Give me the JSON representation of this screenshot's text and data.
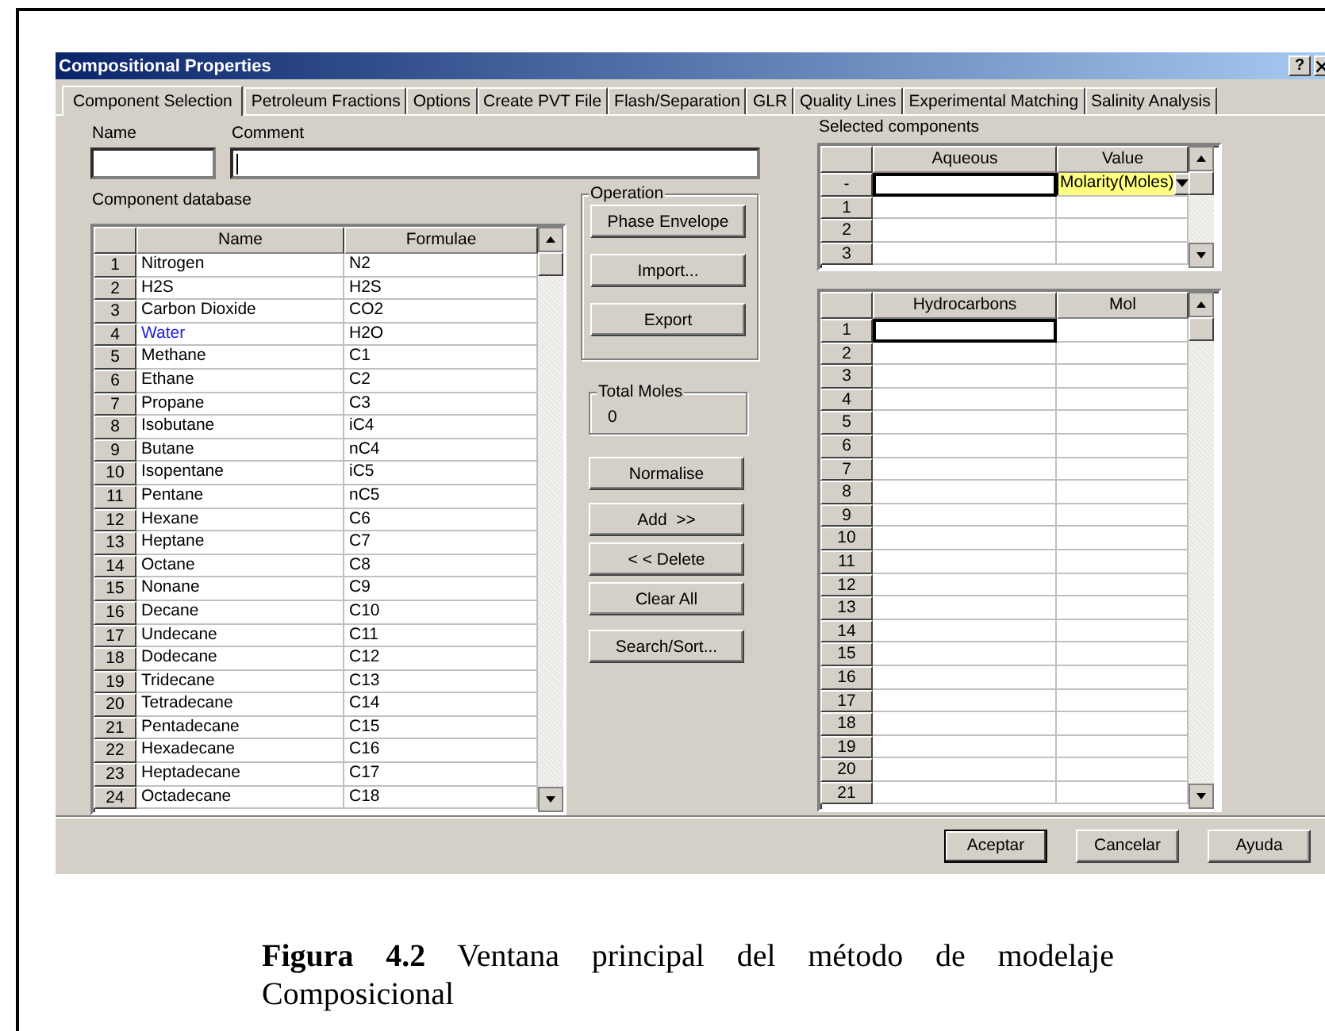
{
  "window": {
    "title": "Compositional Properties",
    "help_button": "?"
  },
  "tabs": [
    {
      "label": "Component Selection",
      "selected": true
    },
    {
      "label": "Petroleum Fractions",
      "selected": false
    },
    {
      "label": "Options",
      "selected": false
    },
    {
      "label": "Create PVT File",
      "selected": false
    },
    {
      "label": "Flash/Separation",
      "selected": false
    },
    {
      "label": "GLR",
      "selected": false
    },
    {
      "label": "Quality Lines",
      "selected": false
    },
    {
      "label": "Experimental Matching",
      "selected": false
    },
    {
      "label": "Salinity Analysis",
      "selected": false
    }
  ],
  "name_field": {
    "label": "Name"
  },
  "comment_field": {
    "label": "Comment",
    "focused": true
  },
  "component_database": {
    "label": "Component database",
    "columns": [
      "Name",
      "Formulae"
    ],
    "rows": [
      {
        "number": "1",
        "name": "Nitrogen",
        "formulae": "N2",
        "highlighted": false
      },
      {
        "number": "2",
        "name": "H2S",
        "formulae": "H2S",
        "highlighted": false
      },
      {
        "number": "3",
        "name": "Carbon Dioxide",
        "formulae": "CO2",
        "highlighted": false
      },
      {
        "number": "4",
        "name": "Water",
        "formulae": "H2O",
        "highlighted": true
      },
      {
        "number": "5",
        "name": "Methane",
        "formulae": "C1",
        "highlighted": false
      },
      {
        "number": "6",
        "name": "Ethane",
        "formulae": "C2",
        "highlighted": false
      },
      {
        "number": "7",
        "name": "Propane",
        "formulae": "C3",
        "highlighted": false
      },
      {
        "number": "8",
        "name": "Isobutane",
        "formulae": "iC4",
        "highlighted": false
      },
      {
        "number": "9",
        "name": "Butane",
        "formulae": "nC4",
        "highlighted": false
      },
      {
        "number": "10",
        "name": "Isopentane",
        "formulae": "iC5",
        "highlighted": false
      },
      {
        "number": "11",
        "name": "Pentane",
        "formulae": "nC5",
        "highlighted": false
      },
      {
        "number": "12",
        "name": "Hexane",
        "formulae": "C6",
        "highlighted": false
      },
      {
        "number": "13",
        "name": "Heptane",
        "formulae": "C7",
        "highlighted": false
      },
      {
        "number": "14",
        "name": "Octane",
        "formulae": "C8",
        "highlighted": false
      },
      {
        "number": "15",
        "name": "Nonane",
        "formulae": "C9",
        "highlighted": false
      },
      {
        "number": "16",
        "name": "Decane",
        "formulae": "C10",
        "highlighted": false
      },
      {
        "number": "17",
        "name": "Undecane",
        "formulae": "C11",
        "highlighted": false
      },
      {
        "number": "18",
        "name": "Dodecane",
        "formulae": "C12",
        "highlighted": false
      },
      {
        "number": "19",
        "name": "Tridecane",
        "formulae": "C13",
        "highlighted": false
      },
      {
        "number": "20",
        "name": "Tetradecane",
        "formulae": "C14",
        "highlighted": false
      },
      {
        "number": "21",
        "name": "Pentadecane",
        "formulae": "C15",
        "highlighted": false
      },
      {
        "number": "22",
        "name": "Hexadecane",
        "formulae": "C16",
        "highlighted": false
      },
      {
        "number": "23",
        "name": "Heptadecane",
        "formulae": "C17",
        "highlighted": false
      },
      {
        "number": "24",
        "name": "Octadecane",
        "formulae": "C18",
        "highlighted": false
      }
    ]
  },
  "operation": {
    "label": "Operation",
    "buttons": [
      "Phase Envelope",
      "Import...",
      "Export"
    ]
  },
  "total_moles": {
    "label": "Total Moles",
    "value": "0"
  },
  "actions": [
    "Normalise",
    "Add  >>",
    "< < Delete",
    "Clear All",
    "Search/Sort..."
  ],
  "selected_components": {
    "label": "Selected components",
    "columns": [
      "Aqueous",
      "Value"
    ],
    "edit_row": {
      "marker": "-",
      "focused": true,
      "value": "Molarity(Moles)"
    },
    "rows": [
      {
        "number": "1"
      },
      {
        "number": "2"
      },
      {
        "number": "3"
      }
    ]
  },
  "hydrocarbons": {
    "columns": [
      "Hydrocarbons",
      "Mol"
    ],
    "rows": [
      {
        "number": "1",
        "focused": true
      },
      {
        "number": "2",
        "focused": false
      },
      {
        "number": "3",
        "focused": false
      },
      {
        "number": "4",
        "focused": false
      },
      {
        "number": "5",
        "focused": false
      },
      {
        "number": "6",
        "focused": false
      },
      {
        "number": "7",
        "focused": false
      },
      {
        "number": "8",
        "focused": false
      },
      {
        "number": "9",
        "focused": false
      },
      {
        "number": "10",
        "focused": false
      },
      {
        "number": "11",
        "focused": false
      },
      {
        "number": "12",
        "focused": false
      },
      {
        "number": "13",
        "focused": false
      },
      {
        "number": "14",
        "focused": false
      },
      {
        "number": "15",
        "focused": false
      },
      {
        "number": "16",
        "focused": false
      },
      {
        "number": "17",
        "focused": false
      },
      {
        "number": "18",
        "focused": false
      },
      {
        "number": "19",
        "focused": false
      },
      {
        "number": "20",
        "focused": false
      },
      {
        "number": "21",
        "focused": false
      }
    ]
  },
  "footer_buttons": [
    {
      "label": "Aceptar",
      "default": true
    },
    {
      "label": "Cancelar",
      "default": false
    },
    {
      "label": "Ayuda",
      "default": false
    }
  ],
  "caption": "**Figura 4.2** Ventana principal del método de modelaje Composicional"
}
